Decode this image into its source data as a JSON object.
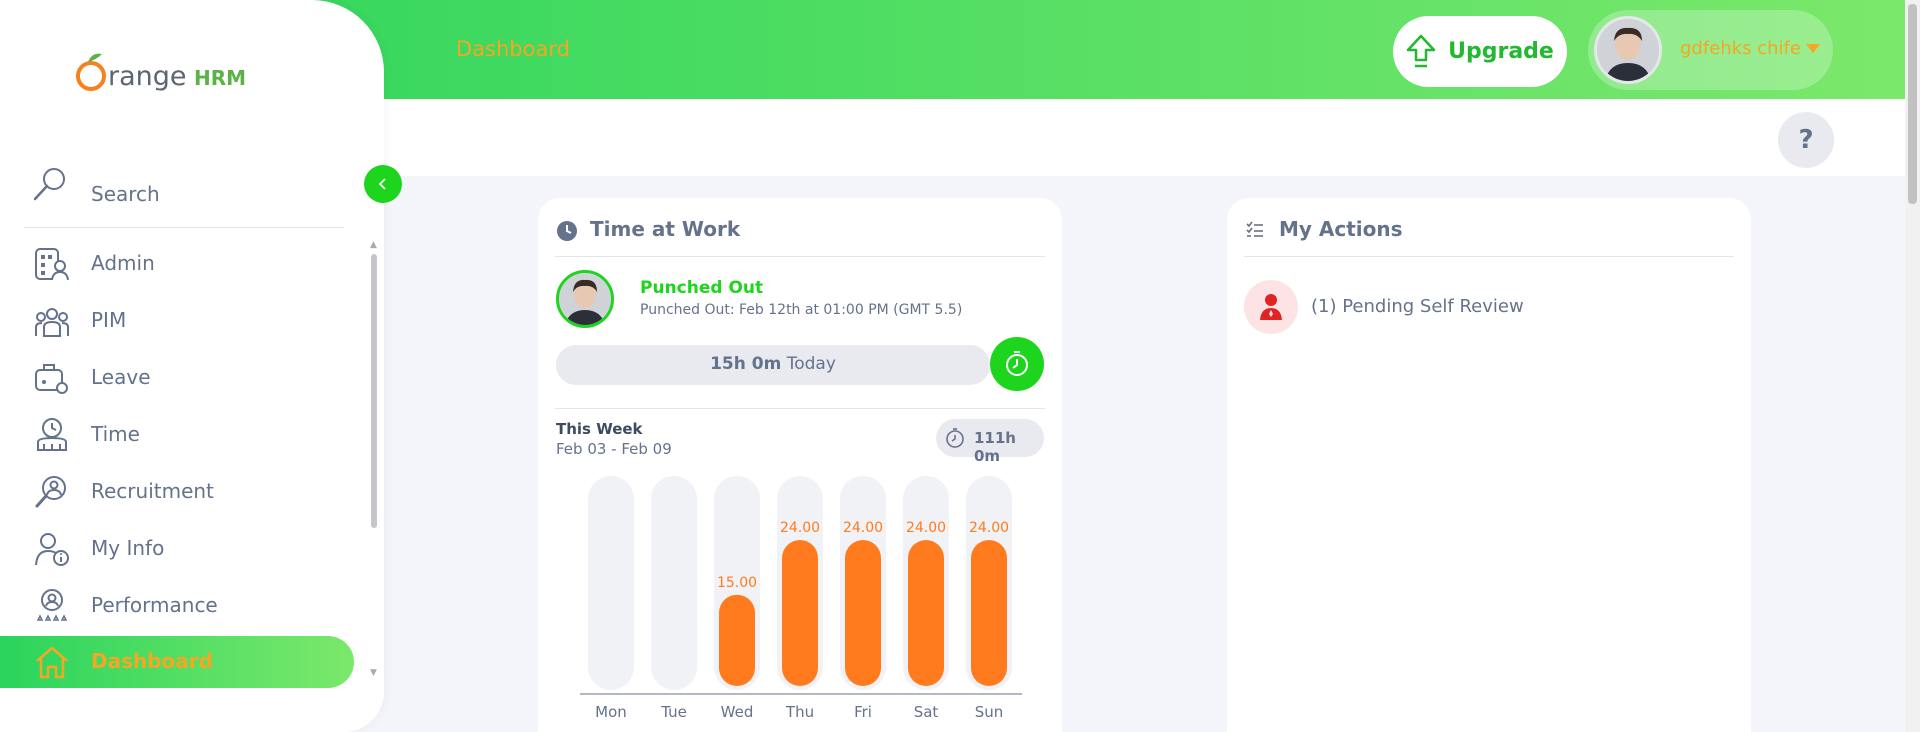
{
  "header": {
    "title": "Dashboard",
    "upgrade_label": "Upgrade",
    "user_name": "gdfehks chife"
  },
  "help": {
    "label": "?"
  },
  "sidebar": {
    "search_label": "Search",
    "items": [
      {
        "label": "Admin",
        "icon": "admin-icon"
      },
      {
        "label": "PIM",
        "icon": "pim-icon"
      },
      {
        "label": "Leave",
        "icon": "leave-icon"
      },
      {
        "label": "Time",
        "icon": "time-icon"
      },
      {
        "label": "Recruitment",
        "icon": "recruitment-icon"
      },
      {
        "label": "My Info",
        "icon": "my-info-icon"
      },
      {
        "label": "Performance",
        "icon": "performance-icon"
      },
      {
        "label": "Dashboard",
        "icon": "home-icon",
        "active": true
      }
    ]
  },
  "time_at_work": {
    "title": "Time at Work",
    "status": "Punched Out",
    "detail": "Punched Out: Feb 12th at 01:00 PM (GMT 5.5)",
    "today_hours": "15h 0m",
    "today_label": "Today",
    "week_label": "This Week",
    "week_range": "Feb 03 - Feb 09",
    "week_total": "111h 0m"
  },
  "my_actions": {
    "title": "My Actions",
    "items": [
      {
        "label": "(1) Pending Self Review"
      }
    ]
  },
  "colors": {
    "accent_green": "#1ed51e",
    "brand_orange": "#f5a623",
    "bar_orange": "#ff7b1d",
    "bar_track": "#f1f2f6"
  },
  "chart_data": {
    "type": "bar",
    "categories": [
      "Mon",
      "Tue",
      "Wed",
      "Thu",
      "Fri",
      "Sat",
      "Sun"
    ],
    "values": [
      0,
      0,
      15.0,
      24.0,
      24.0,
      24.0,
      24.0
    ],
    "labels": [
      "",
      "",
      "15.00",
      "24.00",
      "24.00",
      "24.00",
      "24.00"
    ],
    "ylim": [
      0,
      24
    ],
    "title": "",
    "xlabel": "",
    "ylabel": ""
  }
}
